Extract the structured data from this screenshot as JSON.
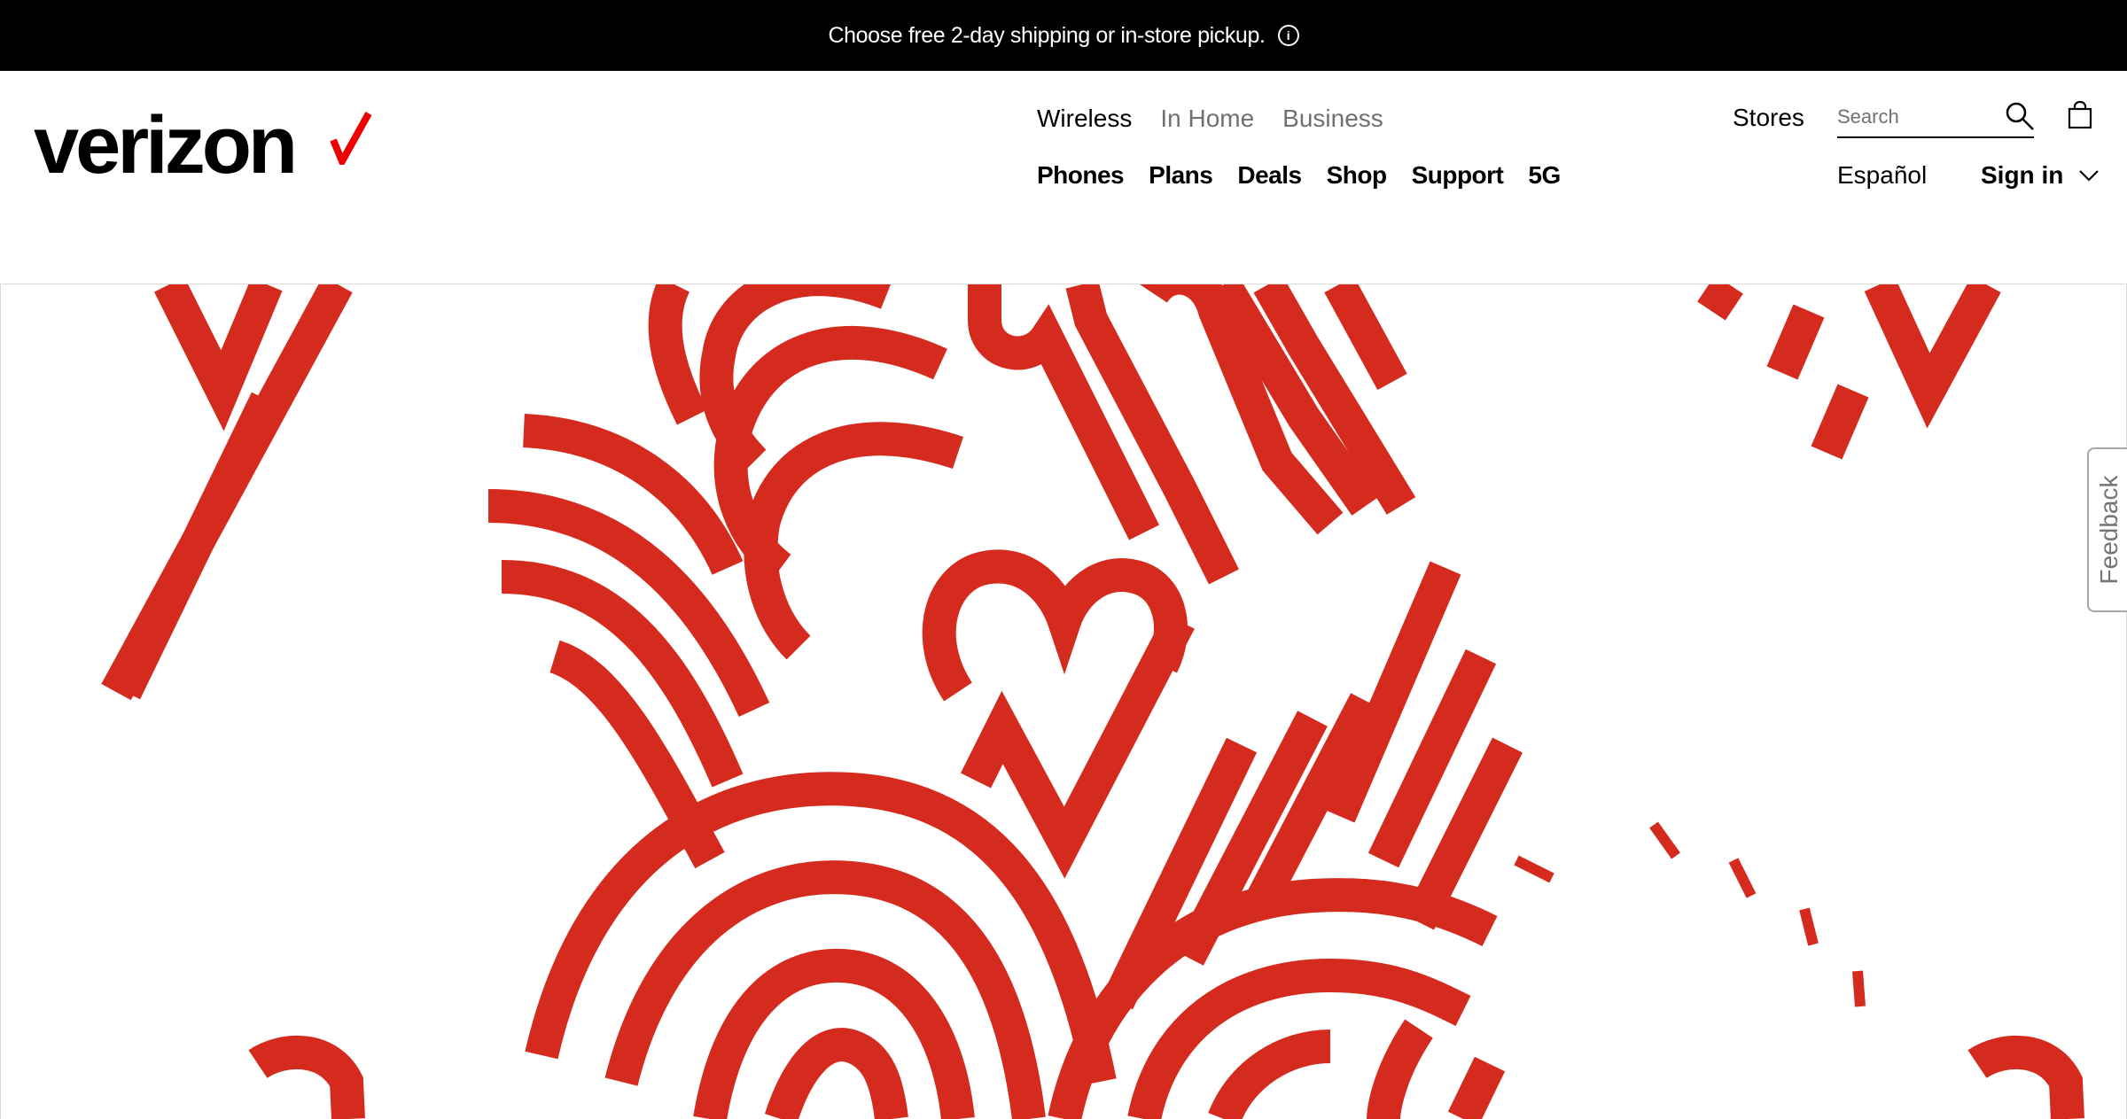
{
  "promo": {
    "text": "Choose free 2-day shipping or in-store pickup.",
    "info_icon": "info-circle-icon"
  },
  "logo": {
    "text": "verizon",
    "check_color": "#ee0000"
  },
  "nav_top": [
    "Wireless",
    "In Home",
    "Business"
  ],
  "nav_main": [
    "Phones",
    "Plans",
    "Deals",
    "Shop",
    "Support",
    "5G"
  ],
  "utility": {
    "stores": "Stores",
    "search_placeholder": "Search",
    "espanol": "Español",
    "signin": "Sign in"
  },
  "feedback": "Feedback",
  "colors": {
    "accent": "#d52b1e",
    "black": "#000000"
  }
}
